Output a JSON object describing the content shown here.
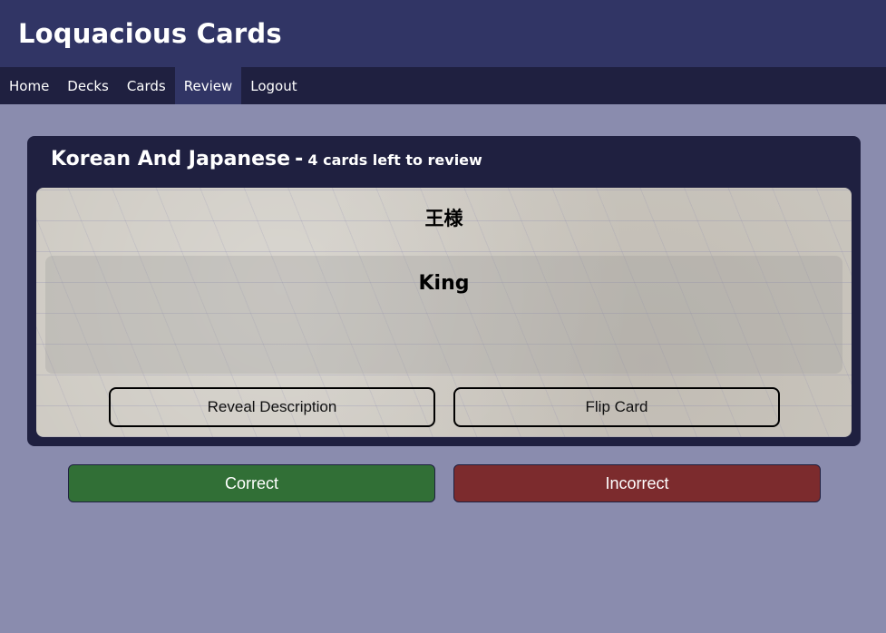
{
  "app": {
    "title": "Loquacious Cards"
  },
  "nav": {
    "items": [
      {
        "label": "Home",
        "active": false
      },
      {
        "label": "Decks",
        "active": false
      },
      {
        "label": "Cards",
        "active": false
      },
      {
        "label": "Review",
        "active": true
      },
      {
        "label": "Logout",
        "active": false
      }
    ]
  },
  "review": {
    "deck_name": "Korean And Japanese",
    "separator": "-",
    "cards_left": "4 cards left to review",
    "card": {
      "front": "王様",
      "back": "King"
    },
    "reveal_description_label": "Reveal Description",
    "flip_card_label": "Flip Card",
    "correct_label": "Correct",
    "incorrect_label": "Incorrect"
  },
  "colors": {
    "header_bg": "#313565",
    "nav_bg": "#1f2040",
    "page_bg": "#8a8cae",
    "correct": "#316f36",
    "incorrect": "#7c2b2d"
  }
}
